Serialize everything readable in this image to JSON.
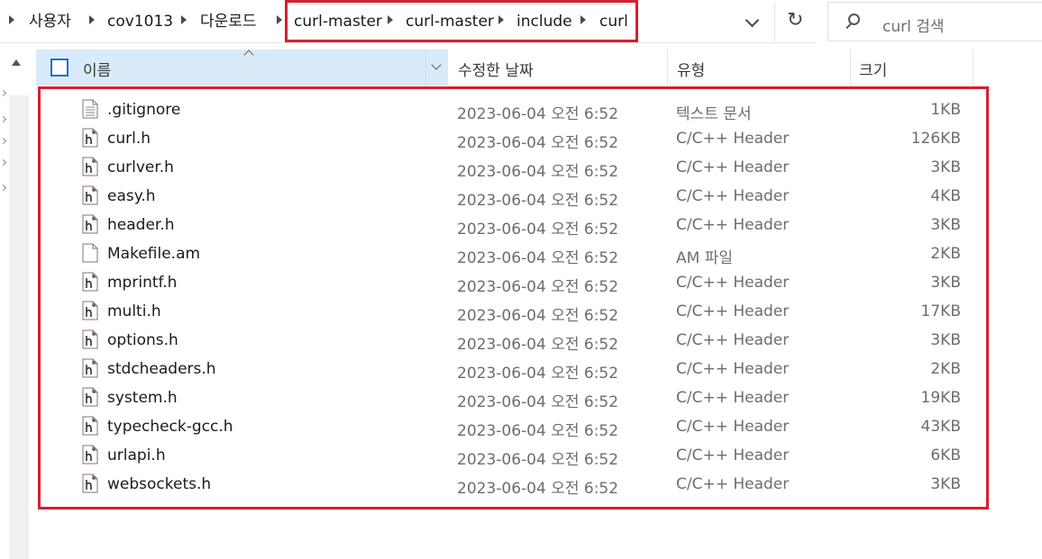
{
  "breadcrumb": {
    "items": [
      "사용자",
      "cov1013",
      "다운로드",
      "curl-master",
      "curl-master",
      "include",
      "curl"
    ]
  },
  "search": {
    "placeholder": "curl 검색"
  },
  "toolbar": {
    "refresh_glyph": "↻"
  },
  "columns": {
    "name": "이름",
    "date": "수정한 날짜",
    "type": "유형",
    "size": "크기"
  },
  "files": [
    {
      "name": ".gitignore",
      "date": "2023-06-04 오전 6:52",
      "type": "텍스트 문서",
      "size": "1KB",
      "icon": "text-file-icon"
    },
    {
      "name": "curl.h",
      "date": "2023-06-04 오전 6:52",
      "type": "C/C++ Header",
      "size": "126KB",
      "icon": "header-file-icon"
    },
    {
      "name": "curlver.h",
      "date": "2023-06-04 오전 6:52",
      "type": "C/C++ Header",
      "size": "3KB",
      "icon": "header-file-icon"
    },
    {
      "name": "easy.h",
      "date": "2023-06-04 오전 6:52",
      "type": "C/C++ Header",
      "size": "4KB",
      "icon": "header-file-icon"
    },
    {
      "name": "header.h",
      "date": "2023-06-04 오전 6:52",
      "type": "C/C++ Header",
      "size": "3KB",
      "icon": "header-file-icon"
    },
    {
      "name": "Makefile.am",
      "date": "2023-06-04 오전 6:52",
      "type": "AM 파일",
      "size": "2KB",
      "icon": "blank-file-icon"
    },
    {
      "name": "mprintf.h",
      "date": "2023-06-04 오전 6:52",
      "type": "C/C++ Header",
      "size": "3KB",
      "icon": "header-file-icon"
    },
    {
      "name": "multi.h",
      "date": "2023-06-04 오전 6:52",
      "type": "C/C++ Header",
      "size": "17KB",
      "icon": "header-file-icon"
    },
    {
      "name": "options.h",
      "date": "2023-06-04 오전 6:52",
      "type": "C/C++ Header",
      "size": "3KB",
      "icon": "header-file-icon"
    },
    {
      "name": "stdcheaders.h",
      "date": "2023-06-04 오전 6:52",
      "type": "C/C++ Header",
      "size": "2KB",
      "icon": "header-file-icon"
    },
    {
      "name": "system.h",
      "date": "2023-06-04 오전 6:52",
      "type": "C/C++ Header",
      "size": "19KB",
      "icon": "header-file-icon"
    },
    {
      "name": "typecheck-gcc.h",
      "date": "2023-06-04 오전 6:52",
      "type": "C/C++ Header",
      "size": "43KB",
      "icon": "header-file-icon"
    },
    {
      "name": "urlapi.h",
      "date": "2023-06-04 오전 6:52",
      "type": "C/C++ Header",
      "size": "6KB",
      "icon": "header-file-icon"
    },
    {
      "name": "websockets.h",
      "date": "2023-06-04 오전 6:52",
      "type": "C/C++ Header",
      "size": "3KB",
      "icon": "header-file-icon"
    }
  ],
  "colors": {
    "highlight": "#d5202e",
    "header_selected": "#d9ebf9",
    "checkbox": "#1d6fc6"
  }
}
